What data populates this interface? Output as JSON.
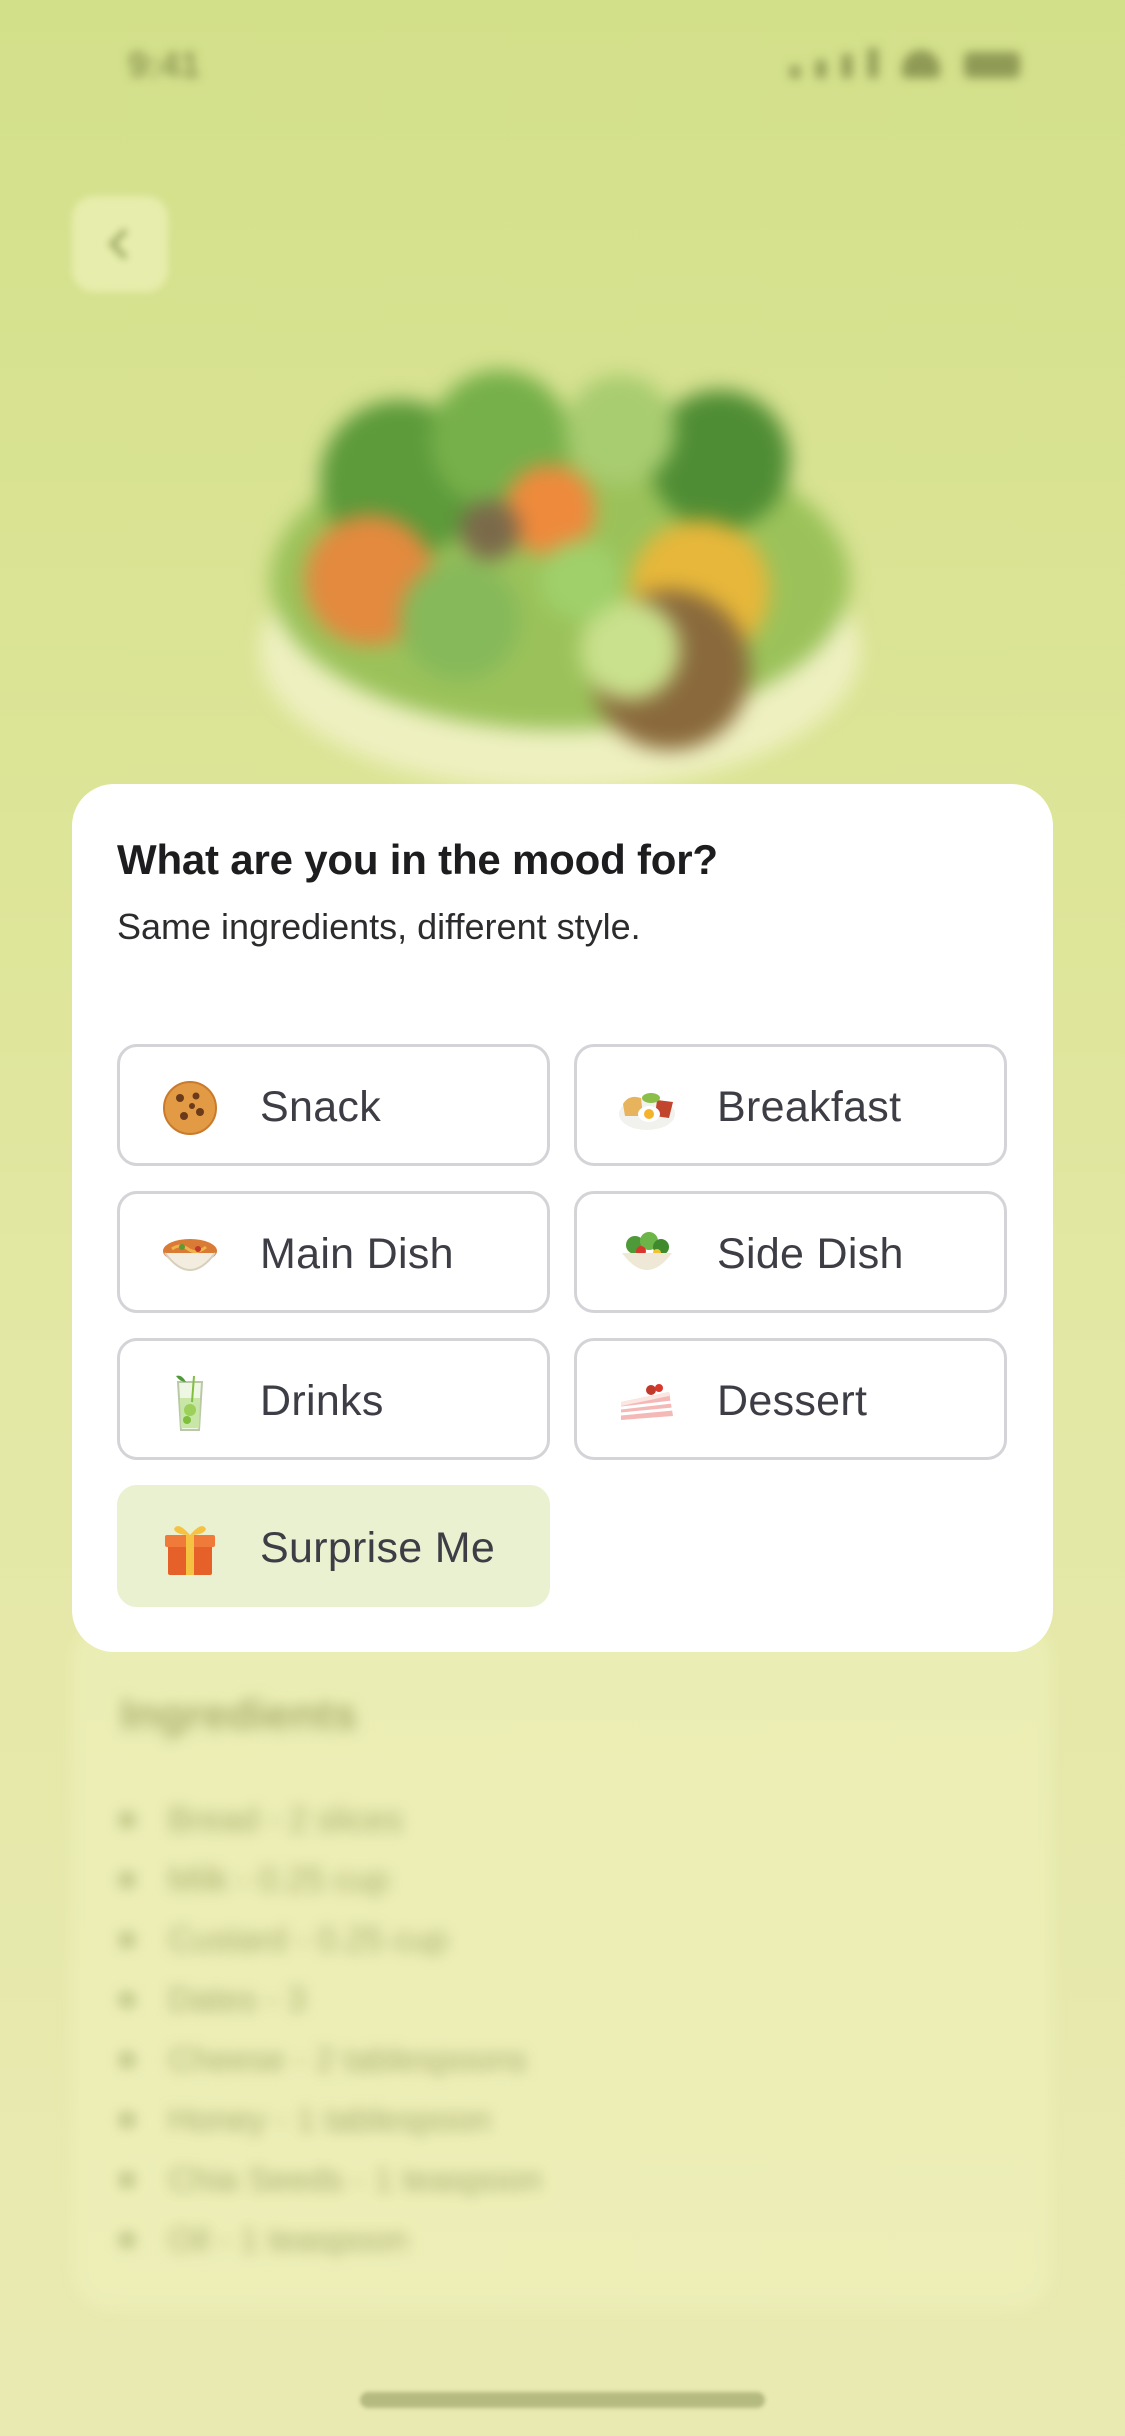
{
  "status_bar": {
    "time": "9:41"
  },
  "background": {
    "ingredients_title": "Ingredients",
    "ingredients": [
      "Bread - 2 slices",
      "Milk - 0.25 cup",
      "Custard - 0.25 cup",
      "Dates - 3",
      "Cheese - 2 tablespoons",
      "Honey - 1 tablespoon",
      "Chia Seeds - 1 teaspoon",
      "Oil - 1 teaspoon"
    ]
  },
  "modal": {
    "title": "What are you in the mood for?",
    "subtitle": "Same ingredients, different style.",
    "options": [
      {
        "label": "Snack",
        "icon": "cookie-icon"
      },
      {
        "label": "Breakfast",
        "icon": "breakfast-plate-icon"
      },
      {
        "label": "Main Dish",
        "icon": "noodle-bowl-icon"
      },
      {
        "label": "Side Dish",
        "icon": "salad-bowl-icon"
      },
      {
        "label": "Drinks",
        "icon": "mojito-glass-icon"
      },
      {
        "label": "Dessert",
        "icon": "cake-slice-icon"
      },
      {
        "label": "Surprise Me",
        "icon": "gift-icon"
      }
    ],
    "highlight_color": "#e9f1d1"
  }
}
